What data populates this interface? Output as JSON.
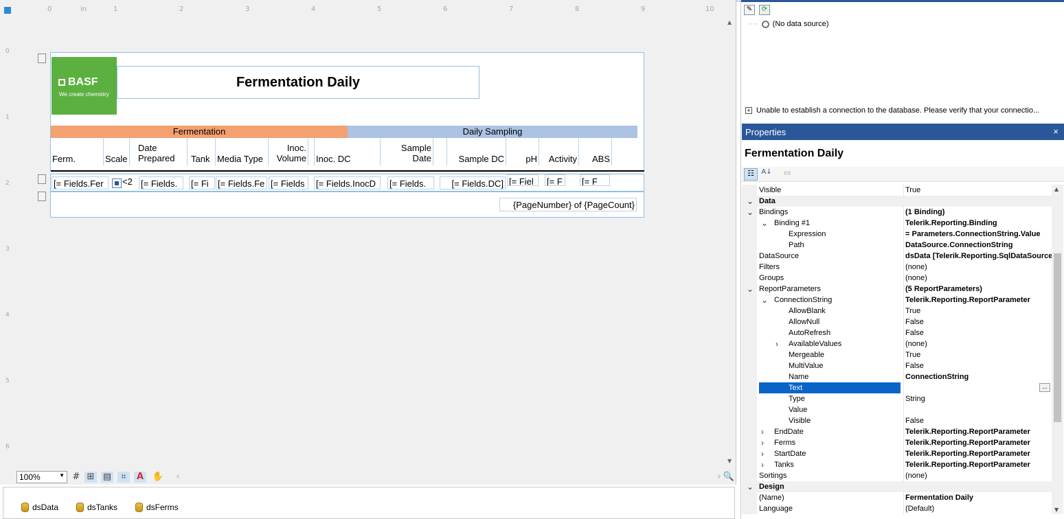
{
  "designer": {
    "ruler_unit": "in",
    "ruler_numbers": [
      "0",
      "1",
      "2",
      "3",
      "4",
      "5",
      "6",
      "7",
      "8",
      "9",
      "10"
    ],
    "vruler_numbers": [
      "0",
      "1",
      "2",
      "3",
      "4",
      "5",
      "6"
    ],
    "logo": {
      "brand": "BASF",
      "tagline": "We create chemistry",
      "color": "#5cb040"
    },
    "title": "Fermentation Daily",
    "group_headers": [
      {
        "label": "Fermentation",
        "color": "#f4a070"
      },
      {
        "label": "Daily Sampling",
        "color": "#adc3e3"
      }
    ],
    "column_headers": [
      "Ferm.",
      "Scale",
      "Date Prepared",
      "Tank",
      "Media Type",
      "Inoc. Volume",
      "Inoc. DC",
      "Sample Date",
      "Sample DC",
      "pH",
      "Activity",
      "ABS"
    ],
    "detail_fields": [
      "[= Fields.Fer",
      "<2",
      "[= Fields.",
      "[= Fi",
      "[= Fields.Fe",
      "[= Fields",
      "[= Fields.InocD",
      "[= Fields.",
      "[= Fields.DC]",
      "[= Fiel",
      "[= F",
      "[= F"
    ],
    "footer": "{PageNumber} of {PageCount}",
    "zoom": "100%"
  },
  "components": [
    "dsData",
    "dsTanks",
    "dsFerms"
  ],
  "explorer": {
    "no_datasource": "(No data source)",
    "error": "Unable to establish a connection to the database. Please verify that your connectio..."
  },
  "properties": {
    "panel_title": "Properties",
    "close": "×",
    "object_name": "Fermentation Daily",
    "rows": [
      {
        "name": "Visible",
        "value": "True",
        "indent": 0
      },
      {
        "name": "Data",
        "value": "",
        "indent": 0,
        "cat": true,
        "exp": "v"
      },
      {
        "name": "Bindings",
        "value": "(1 Binding)",
        "indent": 0,
        "bold": true,
        "exp": "v"
      },
      {
        "name": "Binding #1",
        "value": "Telerik.Reporting.Binding",
        "indent": 1,
        "bold": true,
        "exp": "v"
      },
      {
        "name": "Expression",
        "value": "= Parameters.ConnectionString.Value",
        "indent": 2,
        "bold": true
      },
      {
        "name": "Path",
        "value": "DataSource.ConnectionString",
        "indent": 2,
        "bold": true
      },
      {
        "name": "DataSource",
        "value": "dsData [Telerik.Reporting.SqlDataSource]",
        "indent": 0,
        "bold": true
      },
      {
        "name": "Filters",
        "value": "(none)",
        "indent": 0
      },
      {
        "name": "Groups",
        "value": "(none)",
        "indent": 0
      },
      {
        "name": "ReportParameters",
        "value": "(5 ReportParameters)",
        "indent": 0,
        "bold": true,
        "exp": "v"
      },
      {
        "name": "ConnectionString",
        "value": "Telerik.Reporting.ReportParameter",
        "indent": 1,
        "bold": true,
        "exp": "v"
      },
      {
        "name": "AllowBlank",
        "value": "True",
        "indent": 2
      },
      {
        "name": "AllowNull",
        "value": "False",
        "indent": 2
      },
      {
        "name": "AutoRefresh",
        "value": "False",
        "indent": 2
      },
      {
        "name": "AvailableValues",
        "value": "(none)",
        "indent": 2,
        "exp": ">"
      },
      {
        "name": "Mergeable",
        "value": "True",
        "indent": 2
      },
      {
        "name": "MultiValue",
        "value": "False",
        "indent": 2
      },
      {
        "name": "Name",
        "value": "ConnectionString",
        "indent": 2,
        "bold": true
      },
      {
        "name": "Text",
        "value": "",
        "indent": 2,
        "sel": true
      },
      {
        "name": "Type",
        "value": "String",
        "indent": 2
      },
      {
        "name": "Value",
        "value": "",
        "indent": 2
      },
      {
        "name": "Visible",
        "value": "False",
        "indent": 2
      },
      {
        "name": "EndDate",
        "value": "Telerik.Reporting.ReportParameter",
        "indent": 1,
        "bold": true,
        "exp": ">"
      },
      {
        "name": "Ferms",
        "value": "Telerik.Reporting.ReportParameter",
        "indent": 1,
        "bold": true,
        "exp": ">"
      },
      {
        "name": "StartDate",
        "value": "Telerik.Reporting.ReportParameter",
        "indent": 1,
        "bold": true,
        "exp": ">"
      },
      {
        "name": "Tanks",
        "value": "Telerik.Reporting.ReportParameter",
        "indent": 1,
        "bold": true,
        "exp": ">"
      },
      {
        "name": "Sortings",
        "value": "(none)",
        "indent": 0
      },
      {
        "name": "Design",
        "value": "",
        "indent": 0,
        "cat": true,
        "exp": "v"
      },
      {
        "name": "(Name)",
        "value": "Fermentation Daily",
        "indent": 0,
        "bold": true
      },
      {
        "name": "Language",
        "value": "(Default)",
        "indent": 0
      }
    ]
  }
}
